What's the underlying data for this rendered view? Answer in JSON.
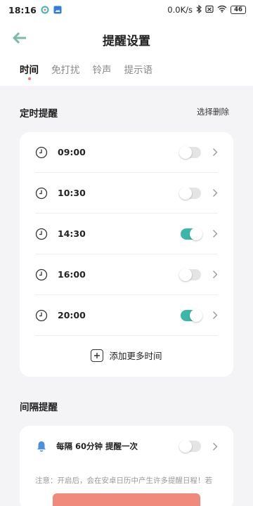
{
  "status_bar": {
    "time": "18:16",
    "network_speed": "0.0K/s",
    "battery": "46",
    "icons": [
      "app-notification-icon",
      "gallery-notification-icon",
      "bluetooth-icon",
      "sim-off-icon",
      "wifi-icon",
      "battery-icon"
    ]
  },
  "header": {
    "title": "提醒设置",
    "back_icon": "back-arrow-icon",
    "tabs": [
      {
        "label": "时间",
        "active": true
      },
      {
        "label": "免打扰",
        "active": false
      },
      {
        "label": "铃声",
        "active": false
      },
      {
        "label": "提示语",
        "active": false
      }
    ]
  },
  "scheduled": {
    "section_title": "定时提醒",
    "select_delete_label": "选择删除",
    "items": [
      {
        "time": "09:00",
        "enabled": false
      },
      {
        "time": "10:30",
        "enabled": false
      },
      {
        "time": "14:30",
        "enabled": true
      },
      {
        "time": "16:00",
        "enabled": false
      },
      {
        "time": "20:00",
        "enabled": true
      }
    ],
    "add_more_label": "添加更多时间"
  },
  "interval": {
    "section_title": "间隔提醒",
    "label": "每隔 60分钟 提醒一次",
    "enabled": false,
    "note": "注意：开启后，会在安卓日历中产生许多提醒日程！若"
  },
  "colors": {
    "accent_teal": "#3bb7aa",
    "tab_dot": "#e8786a",
    "bottom_button": "#f08a7c"
  }
}
